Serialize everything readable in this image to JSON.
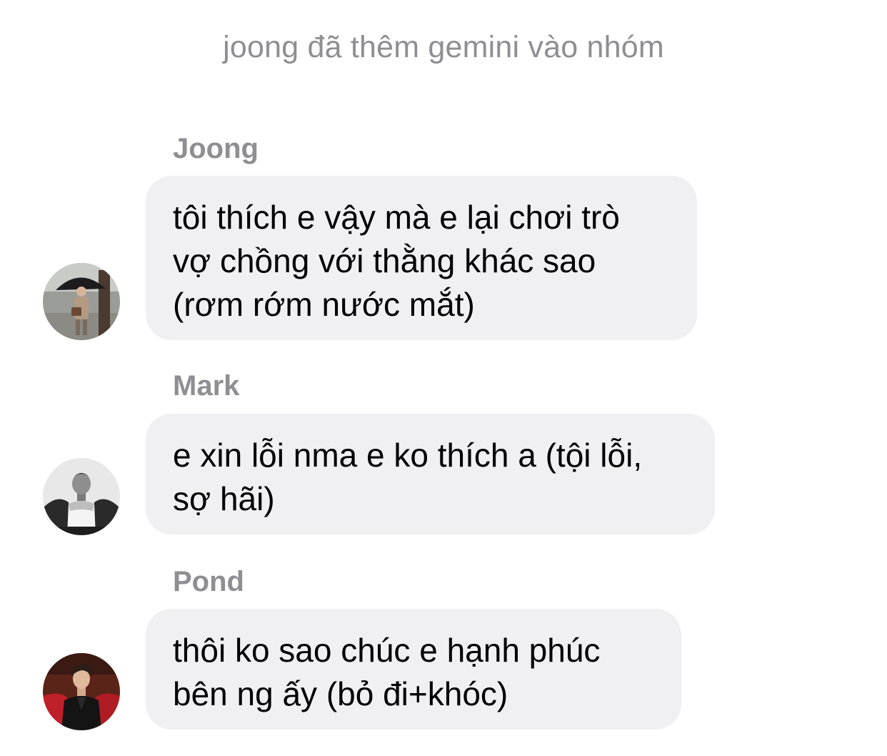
{
  "system_message": "joong đã thêm gemini vào nhóm",
  "messages": [
    {
      "sender": "Joong",
      "lines": [
        "tôi thích e vậy mà e lại chơi trò",
        "vợ chồng với thằng khác sao",
        "(rơm rớm nước mắt)"
      ],
      "avatar_icon": "avatar-photo-umbrella"
    },
    {
      "sender": "Mark",
      "lines": [
        "e xin lỗi nma e ko thích a (tội lỗi,",
        "sợ hãi)"
      ],
      "avatar_icon": "avatar-photo-bw"
    },
    {
      "sender": "Pond",
      "lines": [
        "thôi ko sao chúc e hạnh phúc",
        "bên ng ấy (bỏ đi+khóc)"
      ],
      "avatar_icon": "avatar-photo-red"
    }
  ],
  "colors": {
    "bubble": "#f0f0f2",
    "meta_text": "#8e8e93",
    "message_text": "#000000"
  }
}
